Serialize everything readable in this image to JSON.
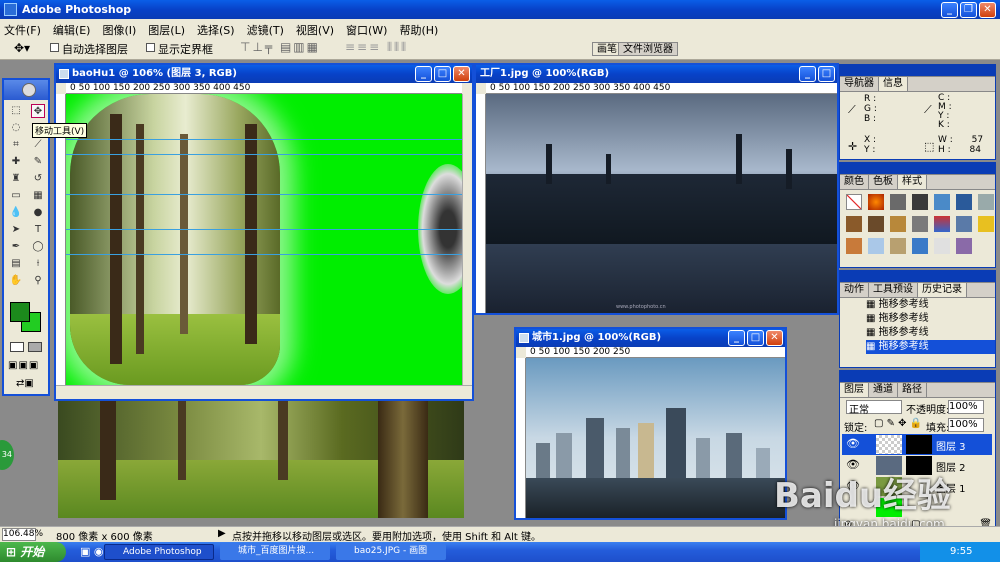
{
  "app": {
    "title": "Adobe Photoshop"
  },
  "menu": [
    "文件(F)",
    "编辑(E)",
    "图像(I)",
    "图层(L)",
    "选择(S)",
    "滤镜(T)",
    "视图(V)",
    "窗口(W)",
    "帮助(H)"
  ],
  "options": {
    "auto_select": "自动选择图层",
    "show_bounds": "显示定界框",
    "tab_brush": "画笔",
    "tab_browser": "文件浏览器"
  },
  "tooltip": "移动工具(V)",
  "docs": {
    "bao": {
      "title": "baoHu1 @ 106% (图层 3, RGB)",
      "ruler": "0     50    100    150    200    250    300    350    400    450"
    },
    "factory": {
      "title": "工厂1.jpg @ 100%(RGB)",
      "ruler": "0  50  100  150  200  250  300  350  400  450",
      "watermark": "www.photophoto.cn"
    },
    "city": {
      "title": "城市1.jpg @ 100%(RGB)",
      "ruler": "0  50  100  150  200  250"
    }
  },
  "navigator": {
    "tab1": "导航器",
    "tab2": "信息",
    "r": "R :",
    "g": "G :",
    "b": "B :",
    "c": "C :",
    "m": "M :",
    "y": "Y :",
    "k": "K :",
    "x": "X :",
    "yy": "Y :",
    "w": "W :",
    "w_val": "57",
    "h": "H :",
    "h_val": "84"
  },
  "swatches": {
    "tab1": "颜色",
    "tab2": "色板",
    "tab3": "样式"
  },
  "history": {
    "tab1": "动作",
    "tab2": "工具预设",
    "tab3": "历史记录",
    "items": [
      "拖移参考线",
      "拖移参考线",
      "拖移参考线",
      "拖移参考线"
    ]
  },
  "layers": {
    "tab1": "图层",
    "tab2": "通道",
    "tab3": "路径",
    "mode": "正常",
    "opacity_label": "不透明度:",
    "opacity": "100%",
    "lock": "锁定:",
    "fill_label": "填充:",
    "fill": "100%",
    "items": [
      "图层 3",
      "图层 2",
      "图层 1"
    ]
  },
  "status": {
    "zoom": "106.48%",
    "size": "800 像素 x 600 像素",
    "hint": "点按并拖移以移动图层或选区。要用附加选项，使用 Shift 和 Alt 键。"
  },
  "taskbar": {
    "start": "开始",
    "items": [
      "Adobe Photoshop",
      "城市_百度图片搜...",
      "bao25.JPG - 画图"
    ],
    "time": "9:55"
  },
  "watermark": {
    "main": "Baidu经验",
    "sub": "jingyan.baidu.com"
  },
  "colors": {
    "fg": "#1c8a1c",
    "bg": "#22cc22",
    "accent": "#0a3cb5"
  }
}
